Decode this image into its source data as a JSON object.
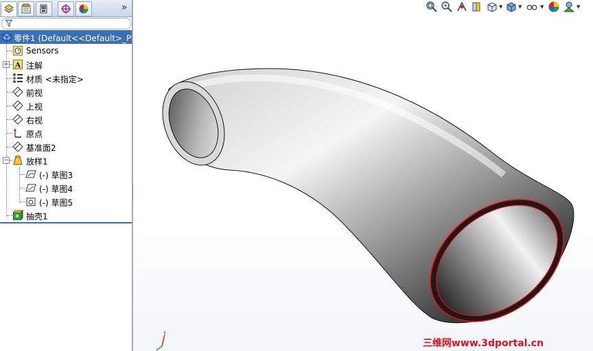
{
  "feature_tree": {
    "root_label": "零件1  (Default<<Default>_Ph",
    "items": [
      {
        "label": "Sensors",
        "icon": "sensors-icon"
      },
      {
        "label": "注解",
        "icon": "annotations-icon"
      },
      {
        "label": "材质 <未指定>",
        "icon": "material-icon"
      },
      {
        "label": "前视",
        "icon": "plane-icon"
      },
      {
        "label": "上视",
        "icon": "plane-icon"
      },
      {
        "label": "右视",
        "icon": "plane-icon"
      },
      {
        "label": "原点",
        "icon": "origin-icon"
      },
      {
        "label": "基准面2",
        "icon": "plane-icon"
      },
      {
        "label": "放样1",
        "icon": "loft-icon"
      },
      {
        "label": "(-) 草图3",
        "icon": "sketch-icon"
      },
      {
        "label": "(-) 草图4",
        "icon": "sketch-icon"
      },
      {
        "label": "(-) 草图5",
        "icon": "sketch-icon"
      },
      {
        "label": "抽壳1",
        "icon": "shell-icon"
      }
    ]
  },
  "tabs": [
    "feature-manager-tab",
    "property-manager-tab",
    "configuration-manager-tab",
    "dimxpert-tab",
    "display-manager-tab"
  ],
  "watermark": "三维网www.3dportal.cn",
  "more_tabs": "»",
  "colors": {
    "selection": "#3d6fb7",
    "watermark": "#e0121f",
    "edge_highlight": "#ff0000"
  }
}
